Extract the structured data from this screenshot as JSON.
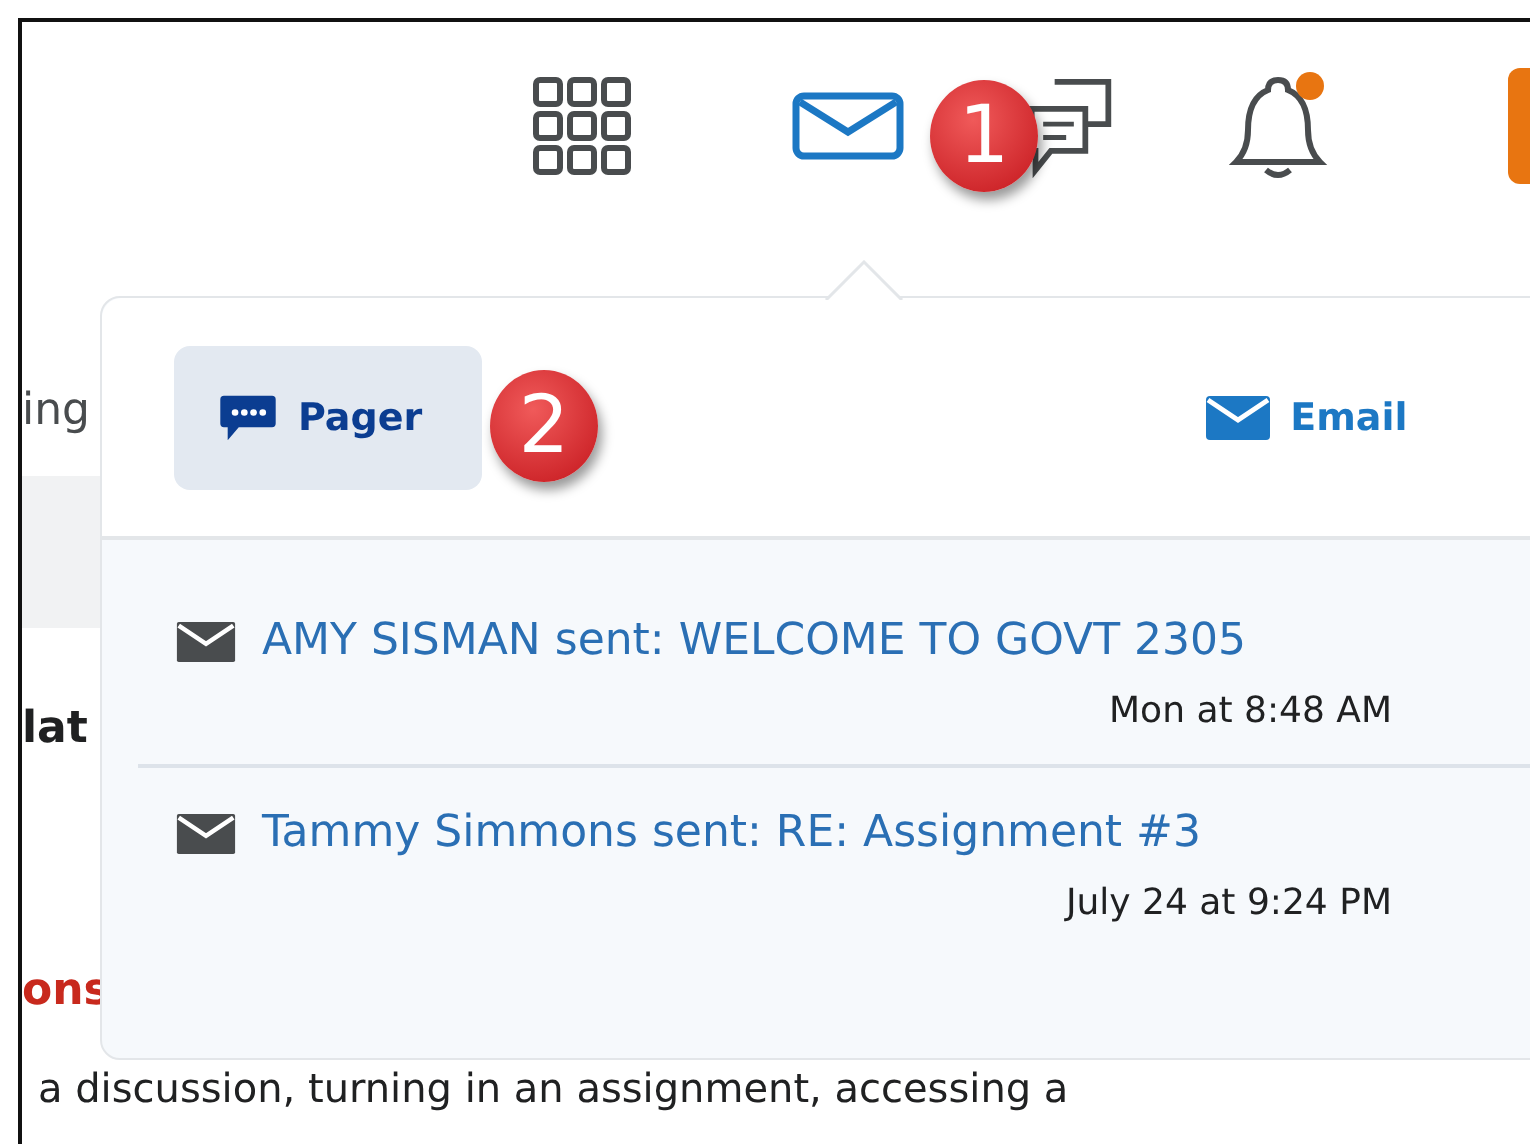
{
  "header": {
    "mail": {
      "selected": true
    },
    "notifications": {
      "unread": true
    }
  },
  "page": {
    "fragments": [
      {
        "kind": "plain",
        "text": "ing"
      },
      {
        "kind": "band"
      },
      {
        "kind": "heading",
        "text": "lat"
      },
      {
        "kind": "alert",
        "text": "ons"
      },
      {
        "kind": "body",
        "text": "a discussion, turning in an assignment, accessing a"
      }
    ]
  },
  "popover": {
    "tabs": [
      {
        "kind": "pager",
        "label": "Pager",
        "selected": true
      },
      {
        "kind": "email",
        "label": "Email",
        "selected": false
      }
    ],
    "messages": [
      {
        "title": "AMY SISMAN sent: WELCOME TO GOVT 2305",
        "time": "Mon at 8:48 AM"
      },
      {
        "title": "Tammy Simmons sent: RE: Assignment #3",
        "time": "July 24 at 9:24 PM"
      }
    ]
  },
  "annotations": [
    {
      "label": "1"
    },
    {
      "label": "2"
    }
  ]
}
